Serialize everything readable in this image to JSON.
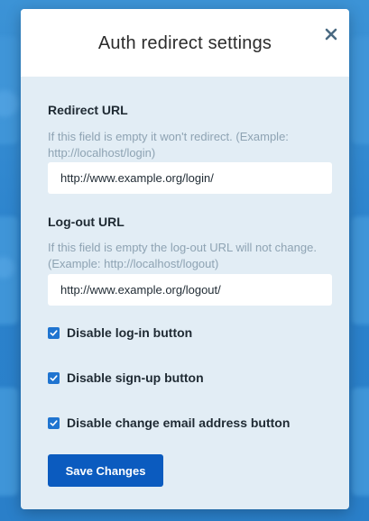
{
  "modal": {
    "title": "Auth redirect settings",
    "close_icon": "close-icon"
  },
  "redirect_url": {
    "label": "Redirect URL",
    "help": "If this field is empty it won't redirect. (Example: http://localhost/login)",
    "value": "http://www.example.org/login/"
  },
  "logout_url": {
    "label": "Log-out URL",
    "help": "If this field is empty the log-out URL will not change. (Example: http://localhost/logout)",
    "value": "http://www.example.org/logout/"
  },
  "options": [
    {
      "label": "Disable log-in button",
      "checked": true
    },
    {
      "label": "Disable sign-up button",
      "checked": true
    },
    {
      "label": "Disable change email address button",
      "checked": true
    }
  ],
  "save_button": {
    "label": "Save Changes"
  },
  "colors": {
    "accent": "#0b5bbf",
    "checkbox": "#1f74d0",
    "modal_body": "#e2edf5",
    "help_text": "#8ea3b3"
  }
}
